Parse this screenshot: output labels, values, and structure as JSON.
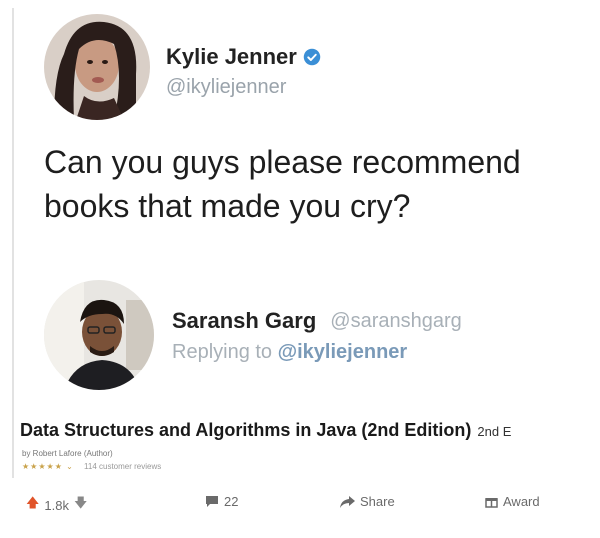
{
  "original_tweet": {
    "display_name": "Kylie Jenner",
    "handle": "@ikyliejenner",
    "verified": true,
    "text_line_1": "Can you guys please recommend",
    "text_line_2": "books that made you cry?"
  },
  "reply_tweet": {
    "display_name": "Saransh Garg",
    "handle": "@saranshgarg",
    "replying_prefix": "Replying to",
    "replying_to": "@ikyliejenner"
  },
  "book": {
    "title": "Data Structures and Algorithms in Java (2nd Edition)",
    "edition": "2nd E",
    "author_line": "by Robert Lafore  (Author)",
    "rating_line": "114 customer reviews"
  },
  "actions": {
    "upvotes": "1.8k",
    "comments": "22",
    "share_label": "Share",
    "award_label": "Award"
  },
  "colors": {
    "verified_blue": "#3b8fd6",
    "handle_gray": "#9aa3ab",
    "upvote_orange": "#e0542a"
  }
}
